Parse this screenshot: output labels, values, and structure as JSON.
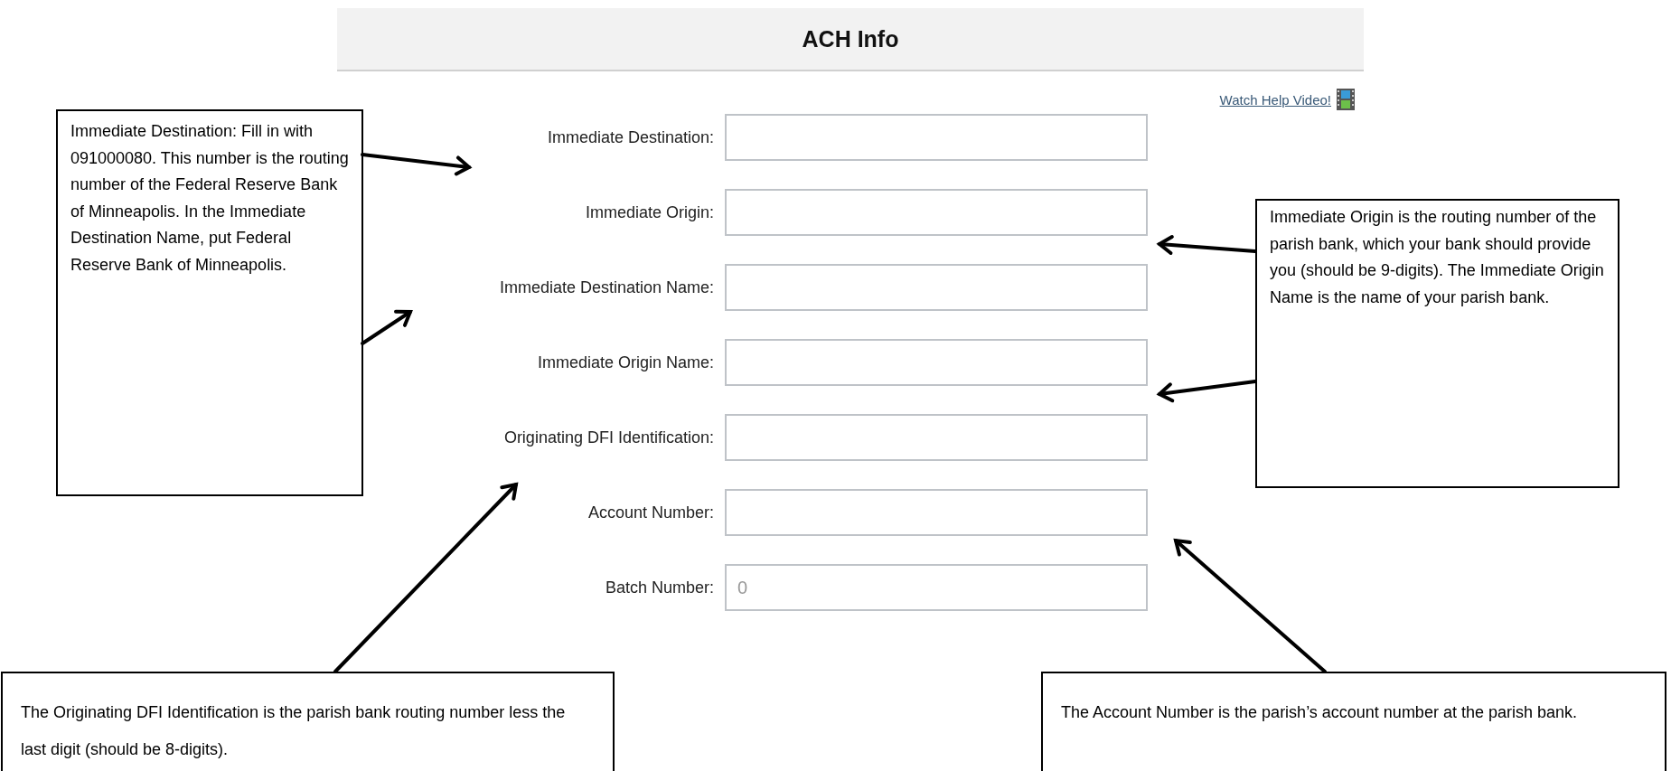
{
  "header": {
    "title": "ACH Info"
  },
  "help_link": {
    "label": "Watch Help Video!"
  },
  "fields": [
    {
      "label": "Immediate Destination:"
    },
    {
      "label": "Immediate Origin:"
    },
    {
      "label": "Immediate Destination Name:"
    },
    {
      "label": "Immediate Origin Name:"
    },
    {
      "label": "Originating DFI Identification:"
    },
    {
      "label": "Account Number:"
    },
    {
      "label": "Batch Number:",
      "placeholder": "0"
    }
  ],
  "callouts": [
    {
      "text": "Immediate Destination: Fill in with 091000080. This number is the routing number of the Federal Reserve Bank of Minneapolis.  In the Immediate Destination Name, put Federal Reserve Bank of Minneapolis."
    },
    {
      "text": "Immediate Origin is the routing number of the parish bank, which your bank should provide you (should be 9-digits).  The Immediate Origin Name is the name of your parish bank."
    },
    {
      "text": "The Originating DFI Identification is the parish bank routing number less the last digit (should be 8-digits)."
    },
    {
      "text": "The Account Number is the parish’s account number at the parish bank."
    }
  ]
}
